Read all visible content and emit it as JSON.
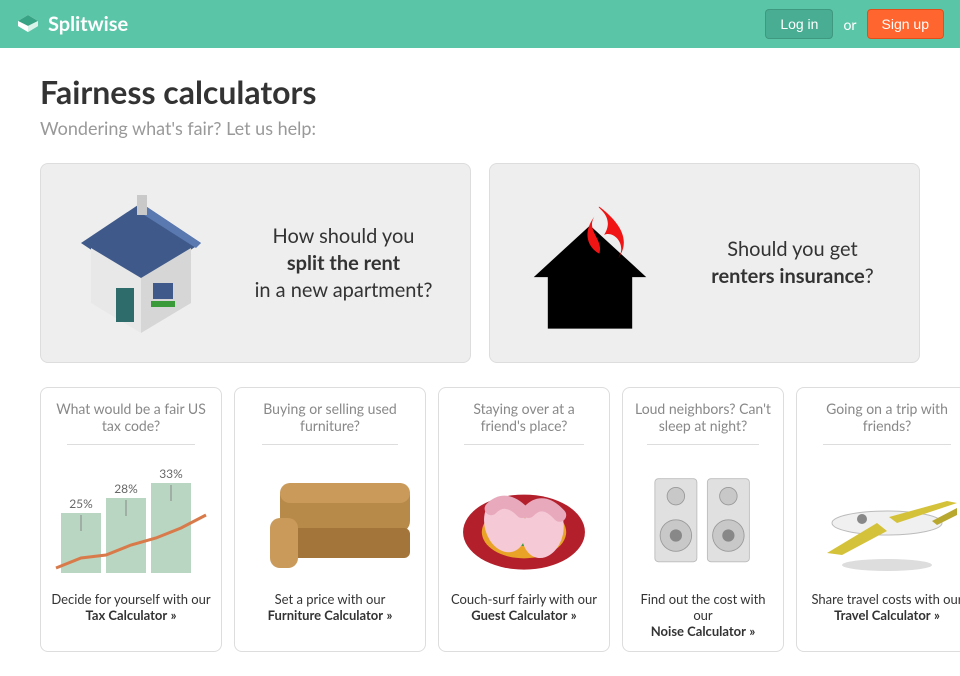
{
  "header": {
    "brand": "Splitwise",
    "login": "Log in",
    "or": "or",
    "signup": "Sign up"
  },
  "page": {
    "title": "Fairness calculators",
    "subtitle": "Wondering what's fair? Let us help:"
  },
  "big_cards": [
    {
      "line1": "How should you",
      "bold": "split the rent",
      "line3": "in a new apartment?",
      "icon": "house-icon"
    },
    {
      "line1": "Should you get",
      "bold": "renters insurance",
      "line3": "?",
      "icon": "house-fire-icon"
    }
  ],
  "small_cards": [
    {
      "question": "What would be a fair US tax code?",
      "lead": "Decide for yourself with our",
      "name": "Tax Calculator",
      "arrow": "»",
      "icon": "tax-chart-icon",
      "chart_labels": [
        "25%",
        "28%",
        "33%"
      ]
    },
    {
      "question": "Buying or selling used furniture?",
      "lead": "Set a price with our",
      "name": "Furniture Calculator",
      "arrow": "»",
      "icon": "couch-icon"
    },
    {
      "question": "Staying over at a friend's place?",
      "lead": "Couch-surf fairly with our",
      "name": "Guest Calculator",
      "arrow": "»",
      "icon": "slippers-icon"
    },
    {
      "question": "Loud neighbors? Can't sleep at night?",
      "lead": "Find out the cost with our",
      "name": "Noise Calculator",
      "arrow": "»",
      "icon": "speakers-icon"
    },
    {
      "question": "Going on a trip with friends?",
      "lead": "Share travel costs with our",
      "name": "Travel Calculator",
      "arrow": "»",
      "icon": "plane-icon"
    }
  ]
}
